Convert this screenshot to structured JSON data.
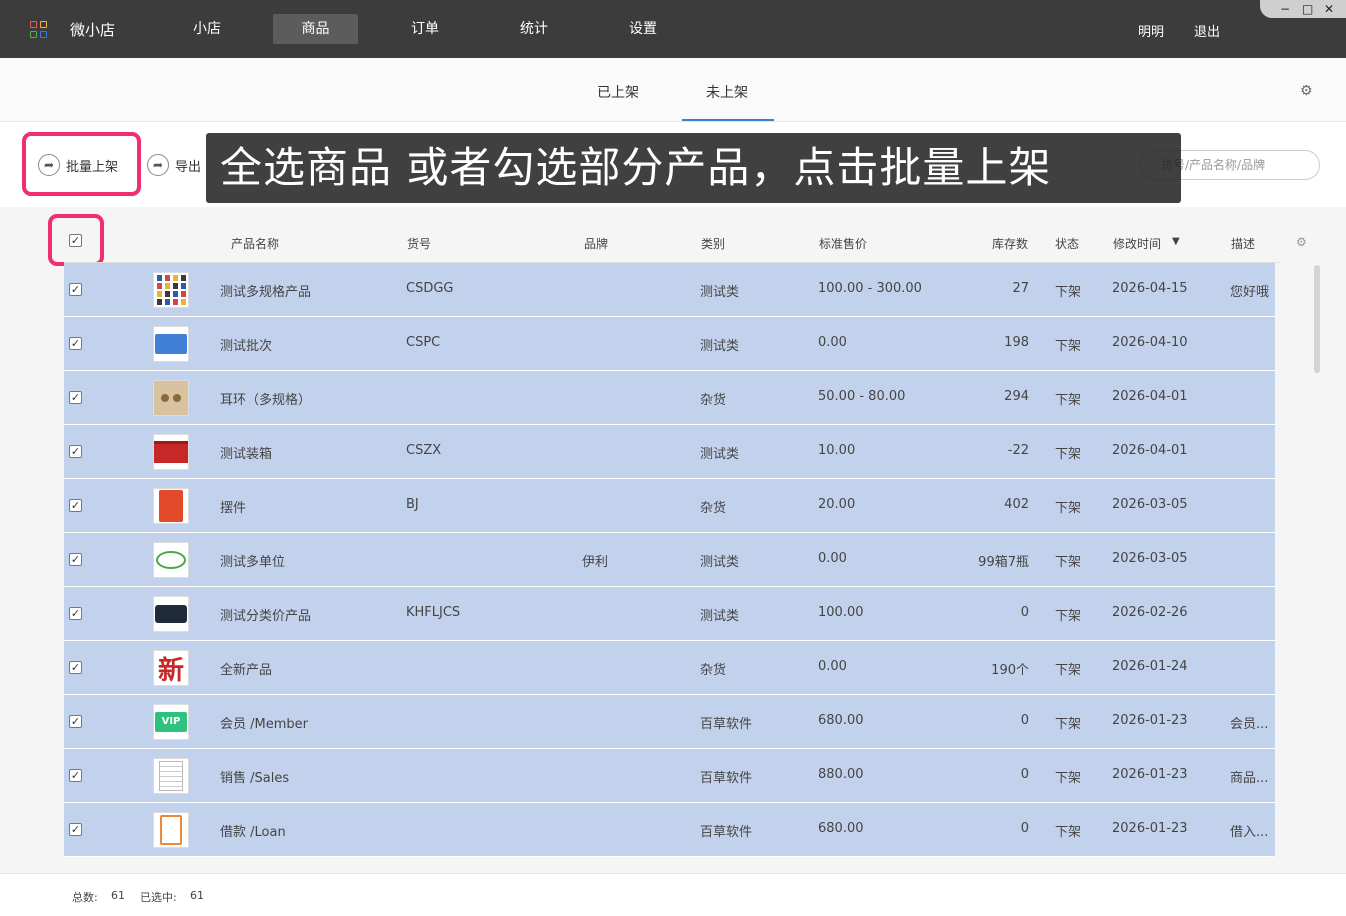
{
  "app": {
    "title": "微小店"
  },
  "nav": {
    "items": [
      {
        "label": "小店",
        "active": false
      },
      {
        "label": "商品",
        "active": true
      },
      {
        "label": "订单",
        "active": false
      },
      {
        "label": "统计",
        "active": false
      },
      {
        "label": "设置",
        "active": false
      }
    ],
    "user": "明明",
    "logout": "退出"
  },
  "window_controls": {
    "minimize": "−",
    "maximize": "□",
    "close": "✕"
  },
  "tabs": {
    "listed": "已上架",
    "unlisted": "未上架",
    "active": "未上架"
  },
  "toolbar": {
    "batch_list": "批量上架",
    "export": "导出",
    "search_placeholder": "货号/产品名称/品牌"
  },
  "banner": {
    "text": "全选商品 或者勾选部分产品，点击批量上架"
  },
  "table": {
    "headers": {
      "name": "产品名称",
      "sku": "货号",
      "brand": "品牌",
      "category": "类别",
      "price": "标准售价",
      "stock": "库存数",
      "status": "状态",
      "modified": "修改时间",
      "sort_arrow": "▼",
      "desc": "描述"
    },
    "rows": [
      {
        "name": "测试多规格产品",
        "sku": "CSDGG",
        "brand": "",
        "category": "测试类",
        "price": "100.00 - 300.00",
        "stock": "27",
        "status": "下架",
        "modified": "2026-04-15",
        "desc": "您好哦",
        "thumb": "figures-grid"
      },
      {
        "name": "测试批次",
        "sku": "CSPC",
        "brand": "",
        "category": "测试类",
        "price": "0.00",
        "stock": "198",
        "status": "下架",
        "modified": "2026-04-10",
        "desc": "",
        "thumb": "blue-card"
      },
      {
        "name": "耳环（多规格）",
        "sku": "",
        "brand": "",
        "category": "杂货",
        "price": "50.00 - 80.00",
        "stock": "294",
        "status": "下架",
        "modified": "2026-04-01",
        "desc": "",
        "thumb": "earrings"
      },
      {
        "name": "测试装箱",
        "sku": "CSZX",
        "brand": "",
        "category": "测试类",
        "price": "10.00",
        "stock": "-22",
        "status": "下架",
        "modified": "2026-04-01",
        "desc": "",
        "thumb": "red-container"
      },
      {
        "name": "摆件",
        "sku": "BJ",
        "brand": "",
        "category": "杂货",
        "price": "20.00",
        "stock": "402",
        "status": "下架",
        "modified": "2026-03-05",
        "desc": "",
        "thumb": "red-calendar"
      },
      {
        "name": "测试多单位",
        "sku": "",
        "brand": "伊利",
        "category": "测试类",
        "price": "0.00",
        "stock": "99箱7瓶",
        "status": "下架",
        "modified": "2026-03-05",
        "desc": "",
        "thumb": "yili-logo"
      },
      {
        "name": "测试分类价产品",
        "sku": "KHFLJCS",
        "brand": "",
        "category": "测试类",
        "price": "100.00",
        "stock": "0",
        "status": "下架",
        "modified": "2026-02-26",
        "desc": "",
        "thumb": "dark-badge"
      },
      {
        "name": "全新产品",
        "sku": "",
        "brand": "",
        "category": "杂货",
        "price": "0.00",
        "stock": "190个",
        "status": "下架",
        "modified": "2026-01-24",
        "desc": "",
        "thumb": "xin-character"
      },
      {
        "name": "会员 /Member",
        "sku": "",
        "brand": "",
        "category": "百草软件",
        "price": "680.00",
        "stock": "0",
        "status": "下架",
        "modified": "2026-01-23",
        "desc": "会员...",
        "thumb": "vip-badge"
      },
      {
        "name": "销售 /Sales",
        "sku": "",
        "brand": "",
        "category": "百草软件",
        "price": "880.00",
        "stock": "0",
        "status": "下架",
        "modified": "2026-01-23",
        "desc": "商品...",
        "thumb": "document"
      },
      {
        "name": "借款 /Loan",
        "sku": "",
        "brand": "",
        "category": "百草软件",
        "price": "680.00",
        "stock": "0",
        "status": "下架",
        "modified": "2026-01-23",
        "desc": "借入...",
        "thumb": "clipboard"
      }
    ]
  },
  "footer": {
    "total_label": "总数:",
    "total": "61",
    "selected_label": "已选中:",
    "selected": "61"
  },
  "colors": {
    "topbar": "#3c3c3c",
    "row_selected": "#c3d2ec",
    "highlight": "#f0306b",
    "tab_underline": "#3a7bd5"
  }
}
